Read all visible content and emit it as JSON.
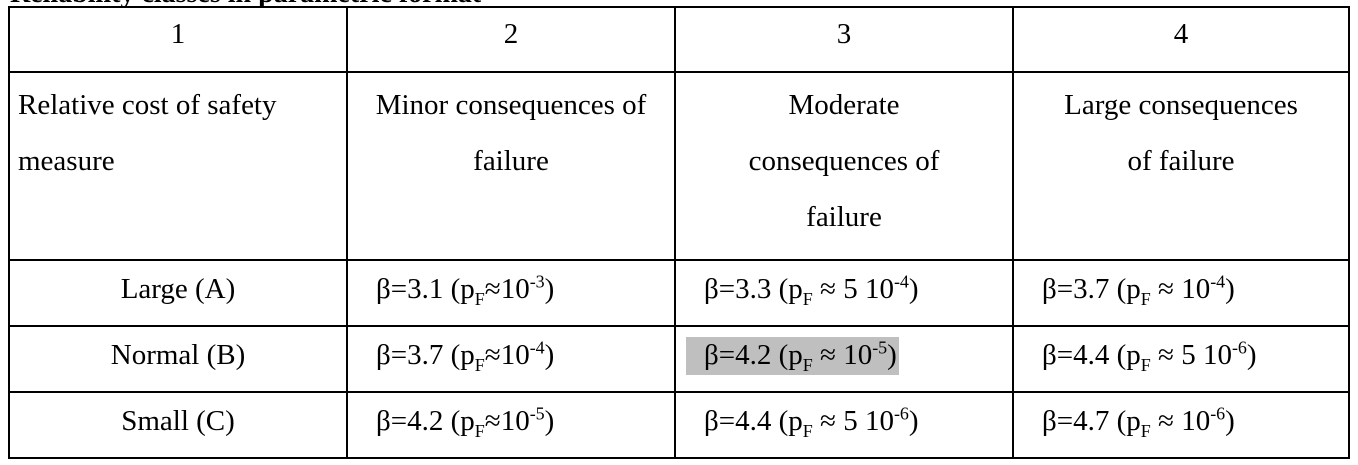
{
  "heading": "Reliability classes in parametric format",
  "table": {
    "column_numbers": [
      "1",
      "2",
      "3",
      "4"
    ],
    "header": {
      "col1": "Relative cost of safety measure",
      "col2": "Minor consequences of failure",
      "col3": "Moderate consequences of failure",
      "col4": "Large consequences of failure"
    },
    "rows": [
      {
        "label": "Large (A)",
        "minor": {
          "beta": "β=3.1 (p",
          "sub": "F",
          "mid": "≈10",
          "sup": "-3",
          "end": ")"
        },
        "moderate": {
          "beta": "β=3.3 (p",
          "sub": "F",
          "mid": " ≈ 5 10",
          "sup": "-4",
          "end": ")"
        },
        "large": {
          "beta": "β=3.7 (p",
          "sub": "F",
          "mid": " ≈ 10",
          "sup": "-4",
          "end": ")"
        }
      },
      {
        "label": "Normal (B)",
        "minor": {
          "beta": "β=3.7 (p",
          "sub": "F",
          "mid": "≈10",
          "sup": "-4",
          "end": ")"
        },
        "moderate": {
          "beta": "β=4.2 (p",
          "sub": "F",
          "mid": " ≈ 10",
          "sup": "-5",
          "end": ")"
        },
        "large": {
          "beta": "β=4.4 (p",
          "sub": "F",
          "mid": " ≈ 5 10",
          "sup": "-6",
          "end": ")"
        }
      },
      {
        "label": "Small (C)",
        "minor": {
          "beta": "β=4.2 (p",
          "sub": "F",
          "mid": "≈10",
          "sup": "-5",
          "end": ")"
        },
        "moderate": {
          "beta": "β=4.4 (p",
          "sub": "F",
          "mid": " ≈ 5 10",
          "sup": "-6",
          "end": ")"
        },
        "large": {
          "beta": "β=4.7 (p",
          "sub": "F",
          "mid": " ≈ 10",
          "sup": "-6",
          "end": ")"
        }
      }
    ],
    "highlight_color": "#bfbfbf"
  }
}
